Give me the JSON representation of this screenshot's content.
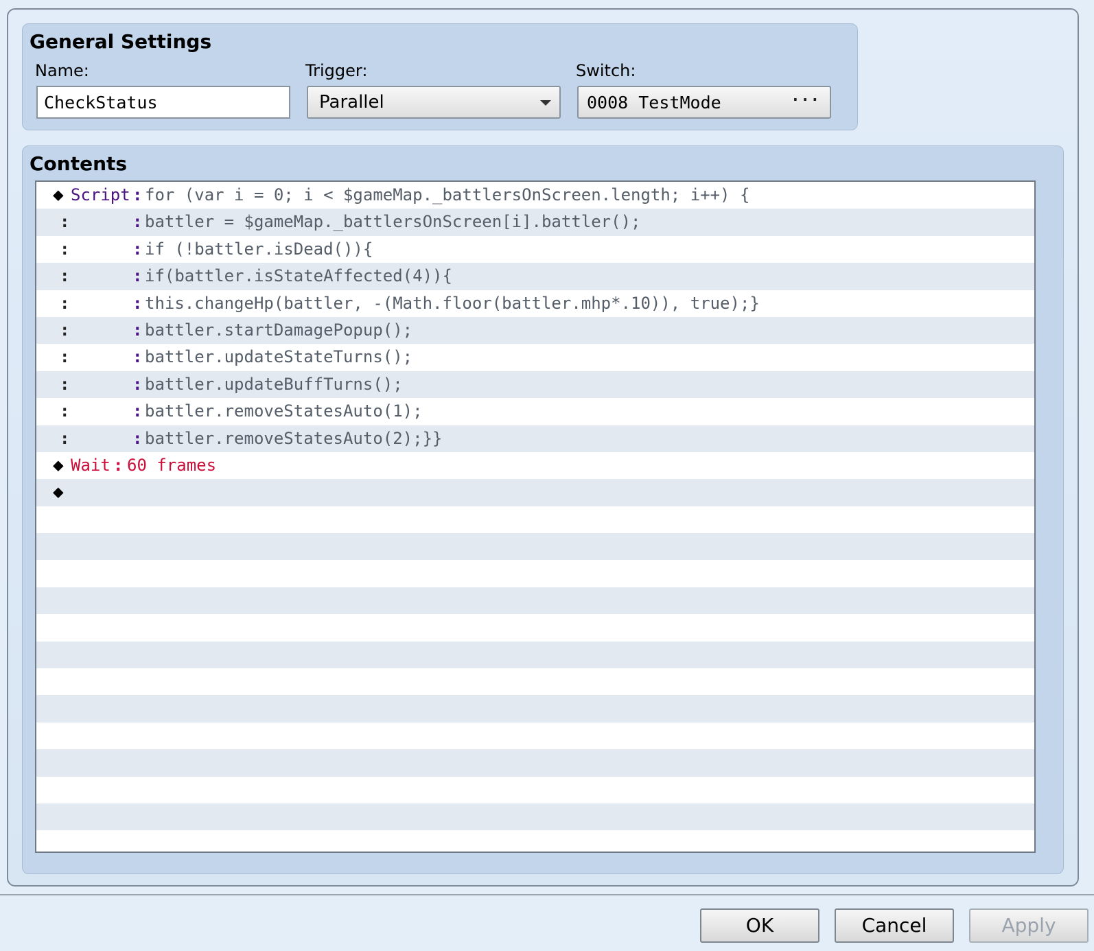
{
  "general": {
    "title": "General Settings",
    "name_label": "Name:",
    "name_value": "CheckStatus",
    "trigger_label": "Trigger:",
    "trigger_value": "Parallel",
    "switch_label": "Switch:",
    "switch_value": "0008 TestMode",
    "switch_button": "···"
  },
  "contents": {
    "title": "Contents",
    "rows": [
      {
        "marker": "◆",
        "command": "Script",
        "sep": ":",
        "text": "for (var i = 0; i < $gameMap._battlersOnScreen.length; i++) {"
      },
      {
        "cont": ":",
        "sep": ":",
        "text": "battler = $gameMap._battlersOnScreen[i].battler();"
      },
      {
        "cont": ":",
        "sep": ":",
        "text": "if (!battler.isDead()){"
      },
      {
        "cont": ":",
        "sep": ":",
        "text": "if(battler.isStateAffected(4)){"
      },
      {
        "cont": ":",
        "sep": ":",
        "text": "this.changeHp(battler, -(Math.floor(battler.mhp*.10)), true);}"
      },
      {
        "cont": ":",
        "sep": ":",
        "text": "battler.startDamagePopup();"
      },
      {
        "cont": ":",
        "sep": ":",
        "text": "battler.updateStateTurns();"
      },
      {
        "cont": ":",
        "sep": ":",
        "text": "battler.updateBuffTurns();"
      },
      {
        "cont": ":",
        "sep": ":",
        "text": "battler.removeStatesAuto(1);"
      },
      {
        "cont": ":",
        "sep": ":",
        "text": "battler.removeStatesAuto(2);}}"
      },
      {
        "marker": "◆",
        "command": "Wait",
        "sep": ":",
        "text": "60 frames"
      },
      {
        "marker": "◆"
      }
    ]
  },
  "buttons": {
    "ok": "OK",
    "cancel": "Cancel",
    "apply": "Apply"
  }
}
